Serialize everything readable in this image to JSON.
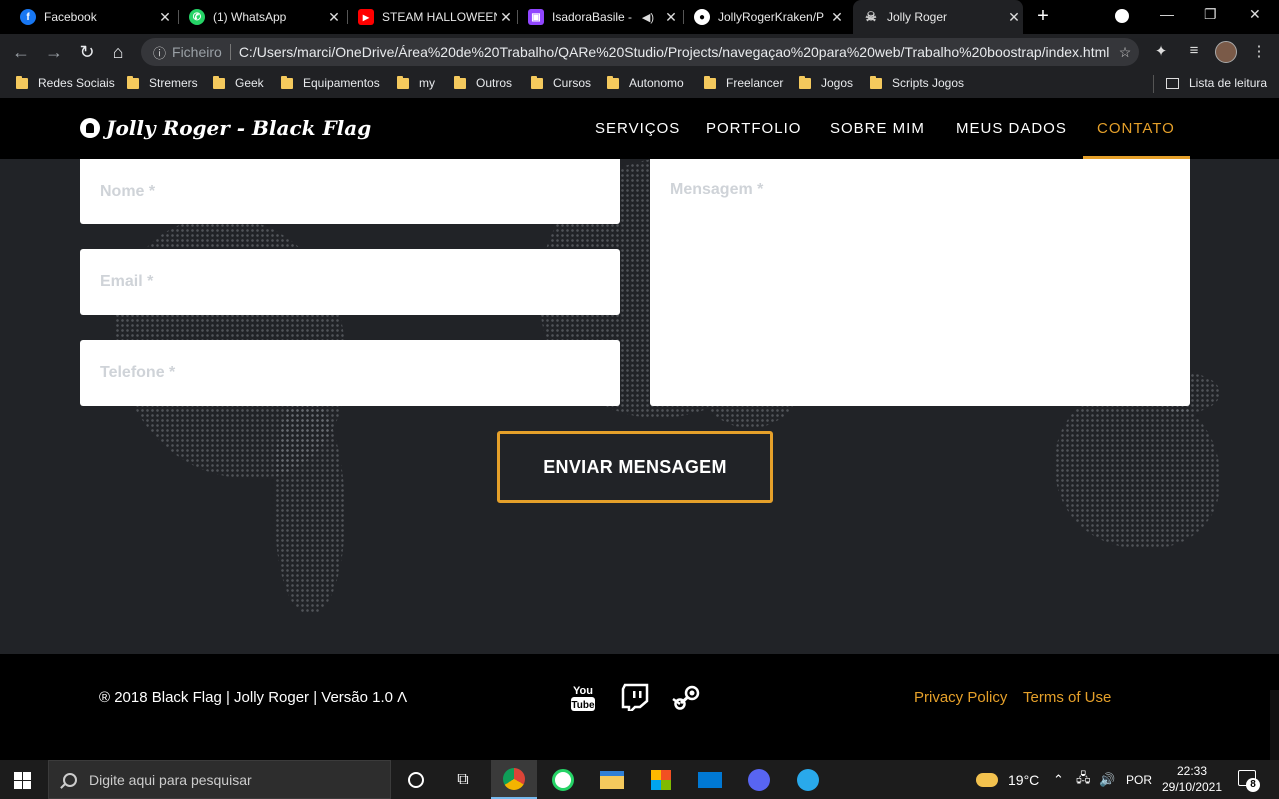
{
  "browser": {
    "tabs": [
      {
        "title": "Facebook",
        "icon": "facebook-icon",
        "color": "#1877f2",
        "glyph": "f"
      },
      {
        "title": "(1) WhatsApp",
        "icon": "whatsapp-icon",
        "color": "#25d366",
        "glyph": "✆"
      },
      {
        "title": "STEAM HALLOWEEN",
        "icon": "youtube-icon",
        "color": "#ff0000",
        "glyph": "▶"
      },
      {
        "title": "IsadoraBasile -",
        "icon": "twitch-icon",
        "color": "#9146ff",
        "glyph": "▣"
      },
      {
        "title": "JollyRogerKraken/P",
        "icon": "github-icon",
        "color": "#ffffff",
        "glyph": "●"
      },
      {
        "title": "Jolly Roger",
        "icon": "jolly-roger-icon",
        "color": "#cccccc",
        "glyph": "☠"
      }
    ],
    "address": {
      "scheme_label": "Ficheiro",
      "url": "C:/Users/marci/OneDrive/Área%20de%20Trabalho/QARe%20Studio/Projects/navegaçao%20para%20web/Trabalho%20boostrap/index.html"
    },
    "bookmarks": [
      "Redes Sociais",
      "Stremers",
      "Geek",
      "Equipamentos",
      "my",
      "Outros",
      "Cursos",
      "Autonomo",
      "Freelancer",
      "Jogos",
      "Scripts Jogos"
    ],
    "reading_list": "Lista de leitura"
  },
  "site": {
    "brand": "Jolly Roger - Black Flag",
    "nav": [
      "SERVIÇOS",
      "PORTFOLIO",
      "SOBRE MIM",
      "MEUS DADOS",
      "CONTATO"
    ],
    "active_nav": "CONTATO",
    "form": {
      "name_placeholder": "Nome *",
      "email_placeholder": "Email *",
      "phone_placeholder": "Telefone *",
      "message_placeholder": "Mensagem *",
      "submit_label": "ENVIAR MENSAGEM"
    },
    "footer": {
      "copyright": "® 2018 Black Flag | Jolly Roger | Versão 1.0 Λ",
      "social": [
        "youtube-icon",
        "twitch-icon",
        "steam-icon"
      ],
      "privacy": "Privacy Policy",
      "terms": "Terms of Use"
    },
    "accent_color": "#e5a02a"
  },
  "taskbar": {
    "search_placeholder": "Digite aqui para pesquisar",
    "weather": "19°C",
    "language": "POR",
    "time": "22:33",
    "date": "29/10/2021",
    "notifications": "8"
  }
}
